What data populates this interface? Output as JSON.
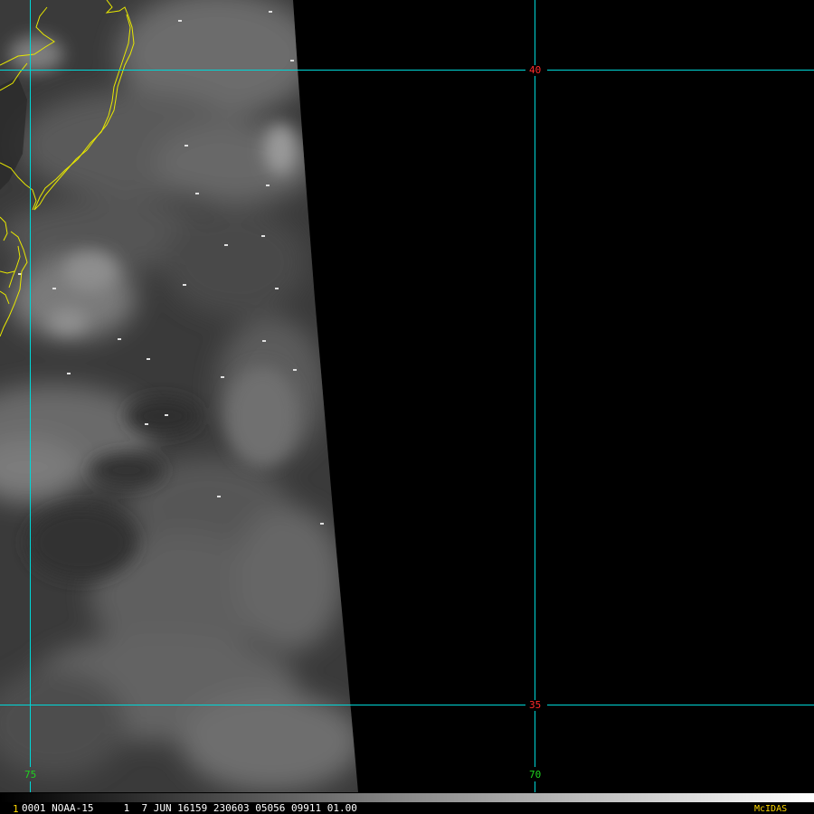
{
  "grid": {
    "latitude_labels": [
      "40",
      "35"
    ],
    "longitude_labels": [
      "75",
      "70"
    ]
  },
  "status_bar": {
    "frame_marker": "1",
    "info": "0001 NOAA-15     1  7 JUN 16159 230603 05056 09911 01.00",
    "brand": "McIDAS"
  },
  "colors": {
    "grid_line": "#00d7d7",
    "latitude_label": "#ff2a2a",
    "longitude_label": "#1fd21f",
    "coastline": "#e8e800",
    "brand": "#ffd800",
    "background": "#000000"
  }
}
